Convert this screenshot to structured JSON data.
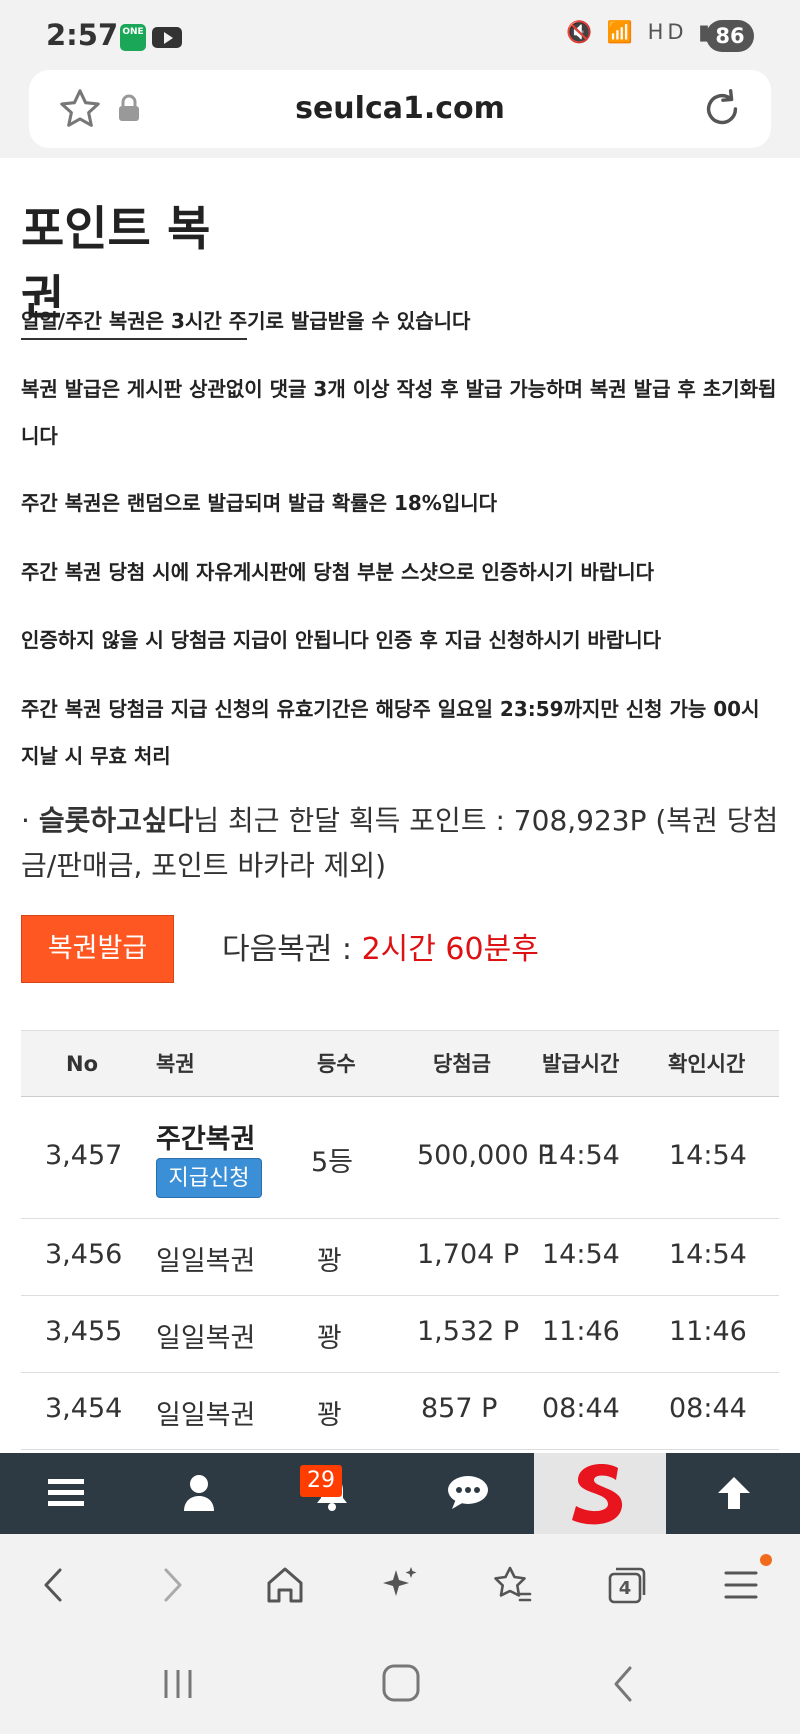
{
  "status_bar": {
    "time": "2:57",
    "app_badge": "ONE",
    "icons": "🔇 📶 HD ▮",
    "battery": "86"
  },
  "address_bar": {
    "url": "seulca1.com"
  },
  "page": {
    "title": "포인트 복권",
    "notices": [
      "일일/주간 복권은 3시간 주기로 발급받을 수 있습니다",
      "복권 발급은 게시판 상관없이 댓글 3개 이상 작성 후 발급 가능하며 복권 발급 후 초기화됩니다",
      "주간 복권은 랜덤으로 발급되며 발급 확률은 18%입니다",
      "주간 복권 당첨 시에 자유게시판에 당첨 부분 스샷으로 인증하시기 바랍니다",
      "인증하지 않을 시 당첨금 지급이 안됩니다 인증 후 지급 신청하시기 바랍니다",
      "주간 복권 당첨금 지급 신청의 유효기간은 해당주 일요일 23:59까지만 신청 가능 00시 지날 시 무효 처리"
    ],
    "summary": {
      "bullet": "· ",
      "username": "슬롯하고싶다",
      "text": "님 최근 한달 획득 포인트 : 708,923P (복권 당첨금/판매금, 포인트 바카라 제외)"
    },
    "issue_button": "복권발급",
    "next_label": "다음복권 : ",
    "next_value": "2시간 60분후"
  },
  "table": {
    "headers": [
      "No",
      "복권",
      "등수",
      "당첨금",
      "발급시간",
      "확인시간"
    ],
    "rows": [
      {
        "no": "3,457",
        "ticket": "주간복권",
        "claim": "지급신청",
        "rank": "5등",
        "prize": "500,000 P",
        "issued": "14:54",
        "checked": "14:54"
      },
      {
        "no": "3,456",
        "ticket": "일일복권",
        "rank": "꽝",
        "prize": "1,704 P",
        "issued": "14:54",
        "checked": "14:54"
      },
      {
        "no": "3,455",
        "ticket": "일일복권",
        "rank": "꽝",
        "prize": "1,532 P",
        "issued": "11:46",
        "checked": "11:46"
      },
      {
        "no": "3,454",
        "ticket": "일일복권",
        "rank": "꽝",
        "prize": "857 P",
        "issued": "08:44",
        "checked": "08:44"
      }
    ]
  },
  "site_nav": {
    "notification_count": "29",
    "icons": [
      "menu-icon",
      "user-icon",
      "bell-icon",
      "chat-icon",
      "logo",
      "arrow-up-icon"
    ]
  },
  "browser_bar": {
    "tab_count": "4"
  },
  "colors": {
    "accent_orange": "#ff5722",
    "claim_blue": "#3a8fd6",
    "next_red": "#dd1111",
    "nav_dark": "#2d3a43"
  }
}
